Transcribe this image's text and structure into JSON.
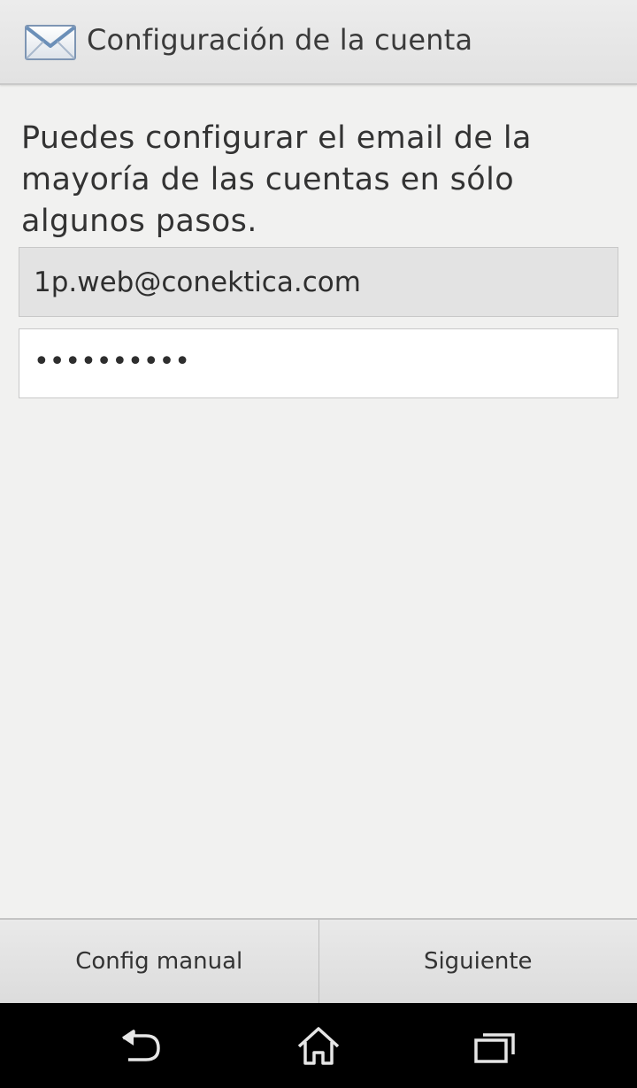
{
  "action_bar": {
    "title": "Configuración de la cuenta",
    "icon": "mail-envelope-icon"
  },
  "intro": {
    "text": "Puedes configurar el email de la mayoría de las cuentas en sólo algunos pasos."
  },
  "form": {
    "email_value": "1p.web@conektica.com",
    "password_value": "••••••••••"
  },
  "buttons": {
    "manual_label": "Config manual",
    "next_label": "Siguiente"
  },
  "navigation": {
    "back_icon": "back-icon",
    "home_icon": "home-icon",
    "recent_icon": "recent-apps-icon"
  },
  "colors": {
    "background": "#f1f1f0",
    "envelope_blue": "#6b8fb8",
    "nav_bar": "#000000"
  }
}
